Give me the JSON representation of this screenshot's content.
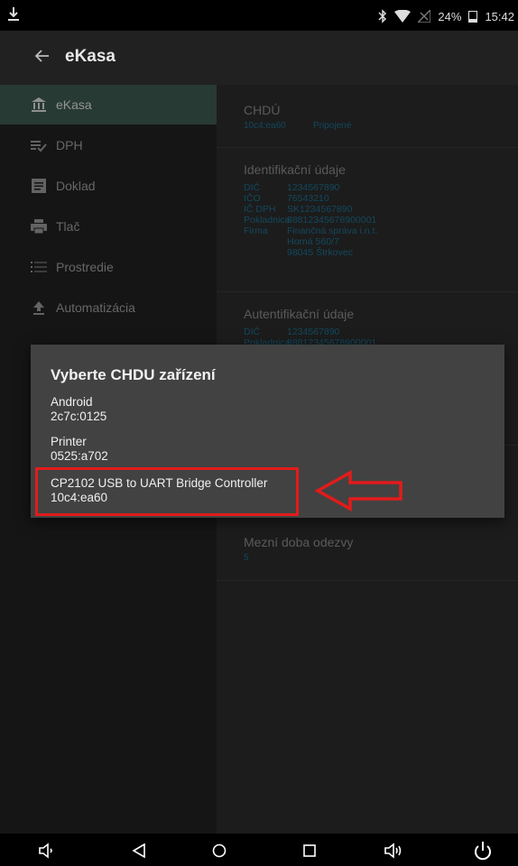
{
  "status": {
    "battery_text": "24%",
    "time": "15:42",
    "icons": [
      "download-icon",
      "bluetooth-icon",
      "wifi-icon",
      "no-signal-icon",
      "battery-icon"
    ]
  },
  "app_bar": {
    "title": "eKasa",
    "back_icon": "arrow-left-icon"
  },
  "sidebar": {
    "items": [
      {
        "label": "eKasa",
        "icon": "bank-icon",
        "active": true
      },
      {
        "label": "DPH",
        "icon": "list-check-icon",
        "active": false
      },
      {
        "label": "Doklad",
        "icon": "document-icon",
        "active": false
      },
      {
        "label": "Tlač",
        "icon": "printer-icon",
        "active": false
      },
      {
        "label": "Prostredie",
        "icon": "list-icon",
        "active": false
      },
      {
        "label": "Automatizácia",
        "icon": "upload-icon",
        "active": false
      }
    ]
  },
  "content": {
    "chdu": {
      "title": "CHDÚ",
      "device": "10c4:ea60",
      "status": "Pripojené"
    },
    "identification": {
      "title": "Identifikační údaje",
      "rows": [
        {
          "key": "DIČ",
          "value": "1234567890"
        },
        {
          "key": "IČO",
          "value": "76543210"
        },
        {
          "key": "IČ DPH",
          "value": "SK1234567890"
        },
        {
          "key": "Pokladnica",
          "value": "88812345678900001"
        },
        {
          "key": "Firma",
          "value": "Finančná správa i.n.t."
        },
        {
          "key": "",
          "value": "Horná 560/7"
        },
        {
          "key": "",
          "value": "98045 Štrkovec"
        }
      ]
    },
    "authentication": {
      "title": "Autentifikační údaje",
      "rows": [
        {
          "key": "DIČ",
          "value": "1234567890"
        },
        {
          "key": "Pokladnica",
          "value": "88812345678900001"
        }
      ]
    },
    "timeout": {
      "title": "Mezní doba odezvy",
      "value": "5"
    }
  },
  "dialog": {
    "title": "Vyberte CHDU zařízení",
    "options": [
      {
        "name": "Android",
        "id": "2c7c:0125"
      },
      {
        "name": "Printer",
        "id": "0525:a702"
      },
      {
        "name": "CP2102 USB to UART Bridge Controller",
        "id": "10c4:ea60"
      }
    ],
    "highlight_color": "#e31b1b"
  },
  "bottom_nav": {
    "icons": [
      "volume-down-icon",
      "back-triangle-icon",
      "home-circle-icon",
      "recents-square-icon",
      "volume-up-icon",
      "power-icon"
    ]
  },
  "colors": {
    "accent": "#3d5a4f",
    "link": "#1d6f8f",
    "dialog_bg": "#424242"
  }
}
